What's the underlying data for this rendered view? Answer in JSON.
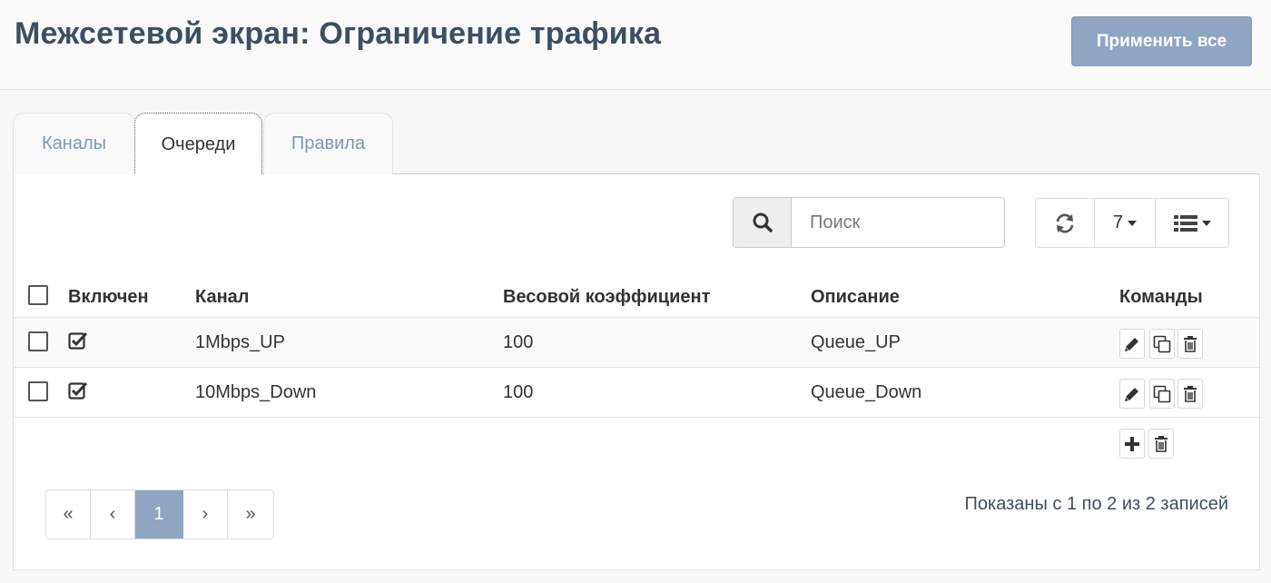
{
  "header": {
    "title": "Межсетевой экран: Ограничение трафика",
    "apply_label": "Применить все"
  },
  "tabs": [
    {
      "label": "Каналы",
      "active": false
    },
    {
      "label": "Очереди",
      "active": true
    },
    {
      "label": "Правила",
      "active": false
    }
  ],
  "toolbar": {
    "search_placeholder": "Поиск",
    "search_value": "",
    "page_size": "7",
    "icons": [
      "search-icon",
      "refresh-icon",
      "columns-list-icon"
    ]
  },
  "table": {
    "columns": [
      "Включен",
      "Канал",
      "Весовой коэффициент",
      "Описание",
      "Команды"
    ],
    "rows": [
      {
        "enabled": true,
        "channel": "1Mbps_UP",
        "weight": "100",
        "description": "Queue_UP"
      },
      {
        "enabled": true,
        "channel": "10Mbps_Down",
        "weight": "100",
        "description": "Queue_Down"
      }
    ]
  },
  "pagination": {
    "first": "«",
    "prev": "‹",
    "current": "1",
    "next": "›",
    "last": "»"
  },
  "footer": {
    "records_info": "Показаны с 1 по 2 из 2 записей"
  },
  "colors": {
    "accent": "#8fa5c2",
    "title": "#3e4e62",
    "tab_inactive": "#8097b8"
  }
}
